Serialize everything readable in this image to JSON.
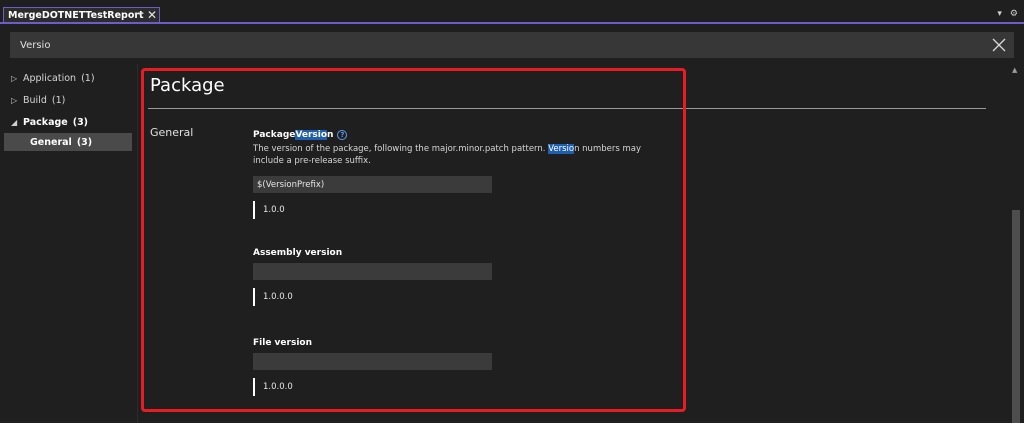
{
  "tab": {
    "title": "MergeDOTNETTestReport",
    "pin_icon": "⊸",
    "close_icon": "✕"
  },
  "tab_tools": {
    "dropdown_icon": "▾",
    "gear_icon": "⚙"
  },
  "search": {
    "value": "Versio"
  },
  "tree": {
    "items": [
      {
        "label": "Application",
        "count": "(1)",
        "caret": "▷"
      },
      {
        "label": "Build",
        "count": "(1)",
        "caret": "▷"
      },
      {
        "label": "Package",
        "count": "(3)",
        "caret": "◢"
      }
    ],
    "child": {
      "label": "General",
      "count": "(3)"
    }
  },
  "main": {
    "title": "Package",
    "section": "General",
    "properties": [
      {
        "title_prefix": "Package ",
        "title_highlight": "Versio",
        "title_suffix": "n",
        "help": "?",
        "desc_part1": "The version of the package, following the major.minor.patch pattern. ",
        "desc_highlight": "Versio",
        "desc_part2": "n numbers may include a pre-release suffix.",
        "input_value": "$(VersionPrefix)",
        "evaluated": "1.0.0"
      },
      {
        "title": "Assembly version",
        "input_value": "",
        "evaluated": "1.0.0.0"
      },
      {
        "title": "File version",
        "input_value": "",
        "evaluated": "1.0.0.0"
      }
    ]
  },
  "colors": {
    "accent": "#6b5fc7",
    "annotation": "#e81c24",
    "highlight": "#1f5fb0"
  }
}
